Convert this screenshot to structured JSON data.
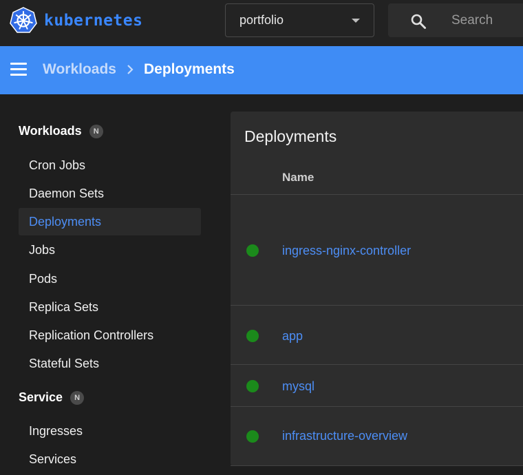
{
  "header": {
    "brand": "kubernetes",
    "namespace": "portfolio",
    "search_placeholder": "Search"
  },
  "toolbar": {
    "breadcrumb_parent": "Workloads",
    "breadcrumb_current": "Deployments"
  },
  "sidebar": {
    "workloads": {
      "label": "Workloads",
      "badge": "N",
      "items": [
        {
          "label": "Cron Jobs"
        },
        {
          "label": "Daemon Sets"
        },
        {
          "label": "Deployments",
          "active": true
        },
        {
          "label": "Jobs"
        },
        {
          "label": "Pods"
        },
        {
          "label": "Replica Sets"
        },
        {
          "label": "Replication Controllers"
        },
        {
          "label": "Stateful Sets"
        }
      ]
    },
    "service": {
      "label": "Service",
      "badge": "N",
      "items": [
        {
          "label": "Ingresses"
        },
        {
          "label": "Services"
        }
      ]
    }
  },
  "main": {
    "card_title": "Deployments",
    "column_name": "Name",
    "rows": [
      {
        "name": "ingress-nginx-controller",
        "status_color": "#1b8a1b"
      },
      {
        "name": "app",
        "status_color": "#1b8a1b"
      },
      {
        "name": "mysql",
        "status_color": "#1b8a1b"
      },
      {
        "name": "infrastructure-overview",
        "status_color": "#1b8a1b"
      }
    ]
  },
  "colors": {
    "brand_blue": "#3a87ff",
    "toolbar_blue": "#3f8cf5",
    "link_blue": "#4d8ef5",
    "status_green": "#1b8a1b"
  },
  "icons": {
    "logo": "kubernetes-helm-wheel-icon",
    "search": "search-icon",
    "menu": "hamburger-menu-icon",
    "separator": "chevron-right-icon",
    "dropdown": "caret-down-icon"
  }
}
